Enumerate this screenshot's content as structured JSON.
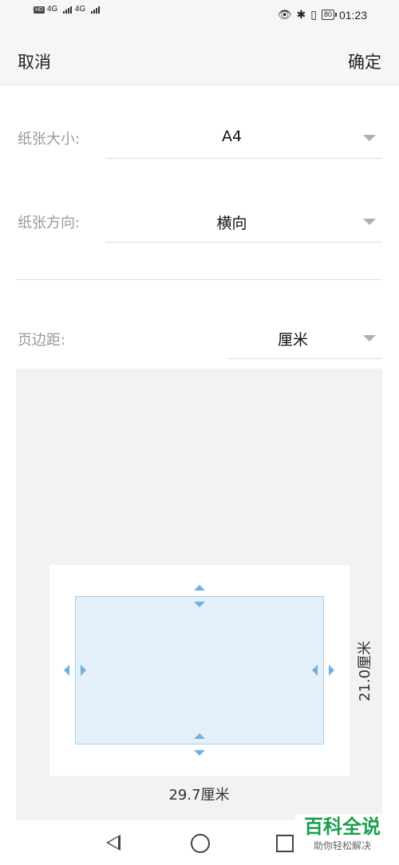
{
  "status_bar": {
    "time": "01:23",
    "battery": "80",
    "network_left": "4G",
    "network_right": "4G"
  },
  "header": {
    "cancel_label": "取消",
    "confirm_label": "确定"
  },
  "paper_size": {
    "label": "纸张大小:",
    "value": "A4"
  },
  "paper_orientation": {
    "label": "纸张方向:",
    "value": "横向"
  },
  "margins": {
    "label": "页边距:",
    "unit_value": "厘米"
  },
  "preview": {
    "width_label": "29.7厘米",
    "height_label": "21.0厘米"
  },
  "watermark": {
    "main": "百科全说",
    "sub": "助你轻松解决"
  },
  "colors": {
    "accent": "#6eb0e0",
    "margin_fill": "#e4f0f9",
    "preview_bg": "#f2f2f2"
  }
}
